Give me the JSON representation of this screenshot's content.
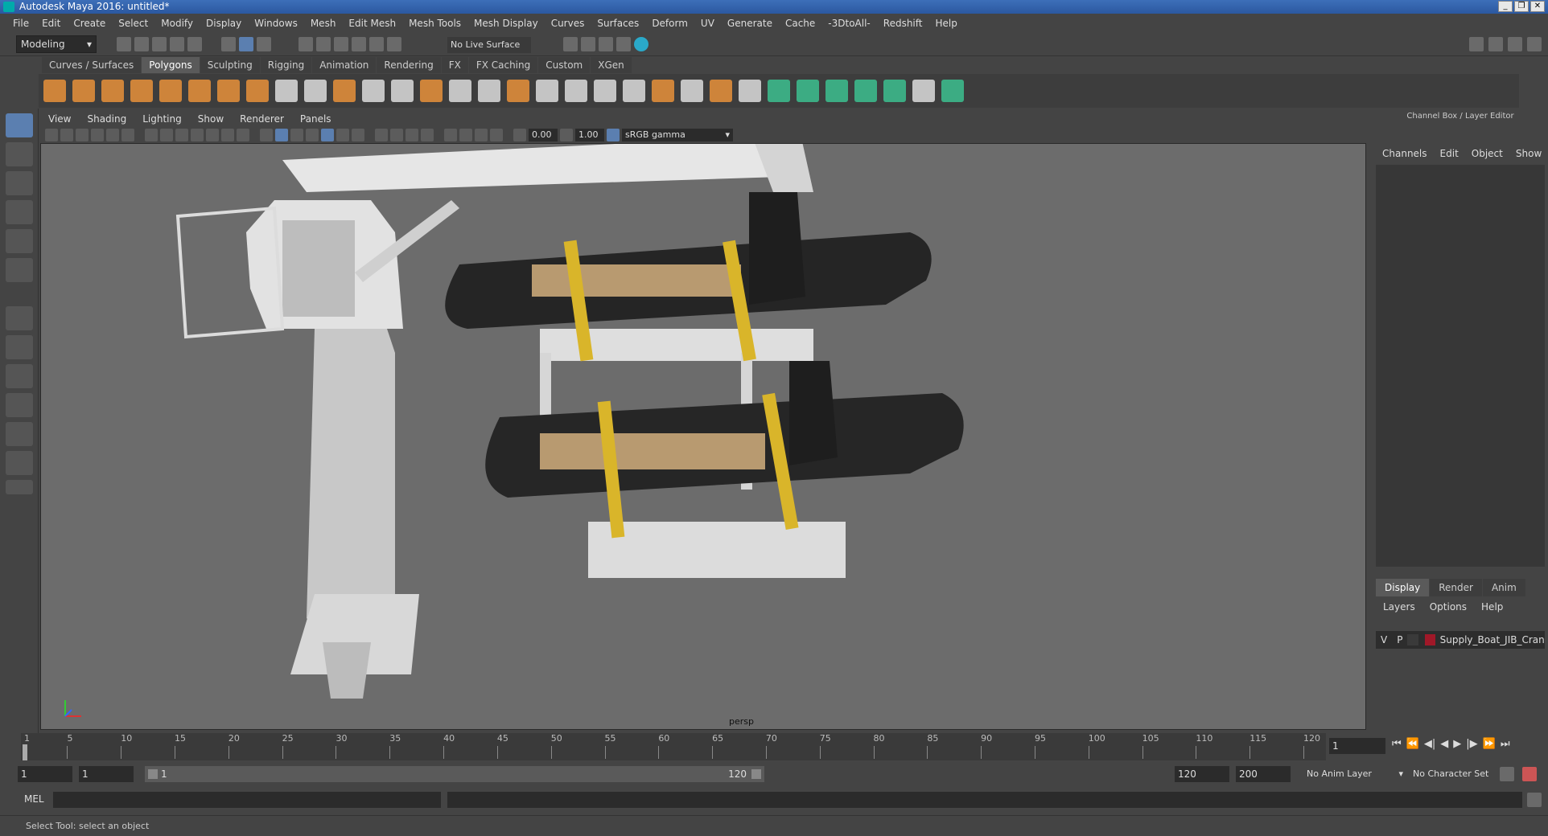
{
  "window": {
    "title": "Autodesk Maya 2016: untitled*"
  },
  "menubar": [
    "File",
    "Edit",
    "Create",
    "Select",
    "Modify",
    "Display",
    "Windows",
    "Mesh",
    "Edit Mesh",
    "Mesh Tools",
    "Mesh Display",
    "Curves",
    "Surfaces",
    "Deform",
    "UV",
    "Generate",
    "Cache",
    "-3DtoAll-",
    "Redshift",
    "Help"
  ],
  "status": {
    "mode": "Modeling",
    "live_surface": "No Live Surface"
  },
  "shelf_tabs": [
    "Curves / Surfaces",
    "Polygons",
    "Sculpting",
    "Rigging",
    "Animation",
    "Rendering",
    "FX",
    "FX Caching",
    "Custom",
    "XGen"
  ],
  "shelf_active": "Polygons",
  "viewport": {
    "menu": [
      "View",
      "Shading",
      "Lighting",
      "Show",
      "Renderer",
      "Panels"
    ],
    "exposure": "0.00",
    "gamma": "1.00",
    "color_space": "sRGB gamma",
    "camera": "persp"
  },
  "channel_box": {
    "title": "Channel Box / Layer Editor",
    "menu": [
      "Channels",
      "Edit",
      "Object",
      "Show"
    ]
  },
  "layer_editor": {
    "tabs": [
      "Display",
      "Render",
      "Anim"
    ],
    "active_tab": "Display",
    "menu": [
      "Layers",
      "Options",
      "Help"
    ],
    "layer": {
      "v": "V",
      "p": "P",
      "name": "Supply_Boat_JIB_Crane",
      "color": "#a01828"
    }
  },
  "timeline": {
    "ticks": [
      "1",
      "5",
      "10",
      "15",
      "20",
      "25",
      "30",
      "35",
      "40",
      "45",
      "50",
      "55",
      "60",
      "65",
      "70",
      "75",
      "80",
      "85",
      "90",
      "95",
      "100",
      "105",
      "110",
      "115",
      "120"
    ],
    "current_frame": "1"
  },
  "range": {
    "start": "1",
    "playback_start": "1",
    "slider_start": "1",
    "slider_end": "120",
    "playback_end": "120",
    "end": "200",
    "anim_layer": "No Anim Layer",
    "char_set": "No Character Set"
  },
  "command_line": {
    "label": "MEL"
  },
  "help_line": {
    "text": "Select Tool: select an object"
  }
}
